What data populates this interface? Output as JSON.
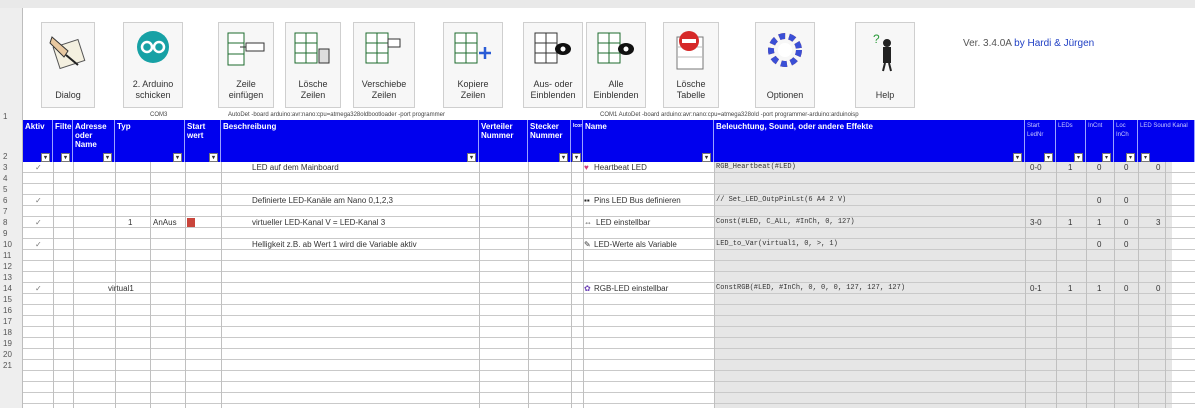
{
  "toolbar": {
    "buttons": [
      {
        "label": "Dialog",
        "icon": "dialog-hand-icon"
      },
      {
        "label": "2. Arduino\nschicken",
        "icon": "arduino-icon"
      },
      {
        "label": "Zeile\neinfügen",
        "icon": "insert-row-icon"
      },
      {
        "label": "Lösche\nZeilen",
        "icon": "delete-rows-icon"
      },
      {
        "label": "Verschiebe\nZeilen",
        "icon": "move-rows-icon"
      },
      {
        "label": "Kopiere\nZeilen",
        "icon": "copy-rows-icon"
      },
      {
        "label": "Aus- oder\nEinblenden",
        "icon": "hide-show-icon"
      },
      {
        "label": "Alle\nEinblenden",
        "icon": "show-all-icon"
      },
      {
        "label": "Lösche\nTabelle",
        "icon": "delete-table-icon"
      },
      {
        "label": "Optionen",
        "icon": "options-icon"
      },
      {
        "label": "Help",
        "icon": "help-icon"
      }
    ],
    "version": "Ver. 3.4.0A",
    "authors": "by Hardi & Jürgen"
  },
  "row1": {
    "com_left": "COM3",
    "board_left": "AutoDet -board arduino:avr:nano:cpu=atmega328oldbootloader -port programmer",
    "board_right": "COM1 AutoDet -board arduino:avr:nano:cpu=atmega328old -port programmer-arduino:arduinoisp"
  },
  "headers": {
    "aktiv": "Aktiv",
    "filter": "Filter",
    "adresse": "Adresse oder Name",
    "typ": "Typ",
    "start": "Start wert",
    "beschreibung": "Beschreibung",
    "verteiler": "Verteiler Nummer",
    "stecker": "Stecker Nummer",
    "icon": "Icon",
    "name": "Name",
    "beleuchtung": "Beleuchtung, Sound, oder andere Effekte",
    "startled": "Start LedNr",
    "leds": "LEDs",
    "inch": "InCnt",
    "loc": "Loc InCh",
    "ledsound": "LED Sound Kanal"
  },
  "row_numbers": [
    "1",
    "2",
    "3",
    "4",
    "5",
    "6",
    "7",
    "8",
    "9",
    "10",
    "11",
    "12",
    "13",
    "14",
    "15",
    "16",
    "17",
    "18",
    "19",
    "20",
    "21"
  ],
  "rows": [
    {
      "aktiv": "✓",
      "adresse": "",
      "typ": "",
      "beschreibung": "LED auf dem Mainboard",
      "name": "Heartbeat LED",
      "effekt": "RGB_Heartbeat(#LED)",
      "startled": "0-0",
      "leds": "1",
      "inch": "0",
      "loc": "0",
      "kanal": "0",
      "icon_color": "#d23b7a"
    },
    {
      "aktiv": "✓",
      "adresse": "",
      "typ": "",
      "beschreibung": "Definierte LED-Kanäle am Nano 0,1,2,3",
      "name": "Pins LED Bus definieren",
      "effekt": "// Set_LED_OutpPinLst(6 A4 2 V)",
      "startled": "",
      "leds": "",
      "inch": "0",
      "loc": "0",
      "kanal": "",
      "icon_color": "#333333"
    },
    {
      "aktiv": "✓",
      "adresse": "1",
      "typ": "AnAus",
      "beschreibung": "virtueller LED-Kanal V = LED-Kanal 3",
      "name": "LED einstellbar",
      "effekt": "Const(#LED, C_ALL, #InCh, 0, 127)",
      "startled": "3-0",
      "leds": "1",
      "inch": "1",
      "loc": "0",
      "kanal": "3",
      "icon_color": "#333333"
    },
    {
      "aktiv": "✓",
      "adresse": "",
      "typ": "",
      "beschreibung": "Helligkeit z.B. ab Wert 1 wird die Variable aktiv",
      "name": "LED-Werte als Variable",
      "effekt": "LED_to_Var(virtual1, 0, >, 1)",
      "startled": "",
      "leds": "",
      "inch": "0",
      "loc": "0",
      "kanal": "",
      "icon_color": "#333333"
    },
    {
      "aktiv": "✓",
      "adresse": "virtual1",
      "typ": "",
      "beschreibung": "",
      "name": "RGB-LED einstellbar",
      "effekt": "ConstRGB(#LED, #InCh, 0, 0, 0, 127, 127, 127)",
      "startled": "0-1",
      "leds": "1",
      "inch": "1",
      "loc": "0",
      "kanal": "0",
      "icon_color": "#6a3fb5"
    }
  ]
}
